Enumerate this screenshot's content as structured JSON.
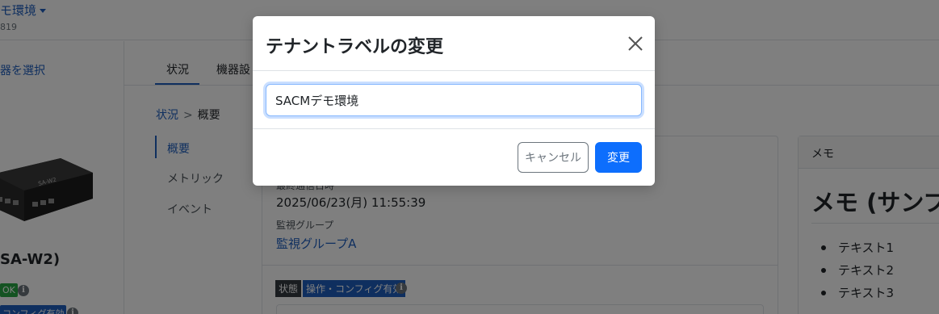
{
  "header": {
    "tenant_name": "モ環境",
    "tenant_id": "819"
  },
  "sidebar": {
    "select_device": "器を選択",
    "device_model": "SA-W2)",
    "ok_badge": "OK",
    "config_badge": "コンフィグ有効"
  },
  "tabs": [
    {
      "label": "状況"
    },
    {
      "label": "機器設"
    }
  ],
  "breadcrumb": {
    "current": "状況",
    "separator": ">",
    "page": "概要"
  },
  "subnav": [
    {
      "label": "概要"
    },
    {
      "label": "メトリック"
    },
    {
      "label": "イベント"
    }
  ],
  "status_card": {
    "last_comm_label": "最終通信日時",
    "last_comm_value": "2025/06/23(月) 11:55:39",
    "group_label": "監視グループ",
    "group_value": "監視グループA",
    "state_label": "状態",
    "state_value": "操作・コンフィグ有効"
  },
  "memo": {
    "title": "メモ",
    "heading": "メモ (サンプ",
    "items": [
      "テキスト1",
      "テキスト2",
      "テキスト3"
    ]
  },
  "modal": {
    "title": "テナントラベルの変更",
    "input_value": "SACMデモ環境",
    "cancel_label": "キャンセル",
    "submit_label": "変更"
  },
  "colors": {
    "accent": "#0d6efd",
    "link": "#1f5fbf",
    "ok": "#28a745",
    "backdrop": "rgba(0,0,0,0.5)"
  }
}
